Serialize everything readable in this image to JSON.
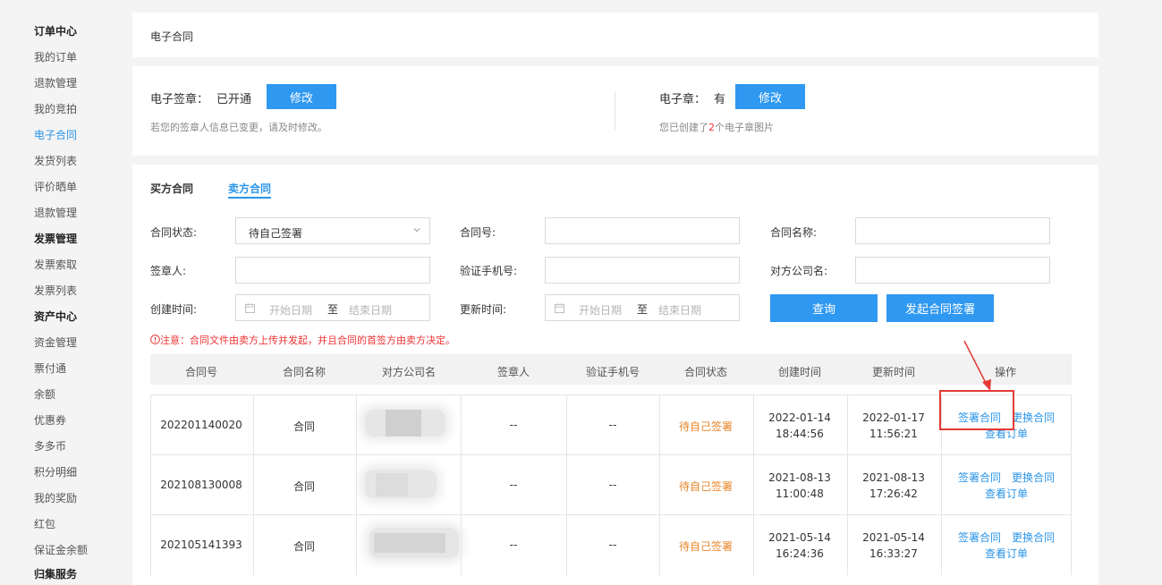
{
  "sidebar": {
    "items": [
      {
        "label": "订单中心",
        "type": "head"
      },
      {
        "label": "我的订单",
        "type": "item"
      },
      {
        "label": "退款管理",
        "type": "item"
      },
      {
        "label": "我的竞拍",
        "type": "item"
      },
      {
        "label": "电子合同",
        "type": "active"
      },
      {
        "label": "发货列表",
        "type": "item"
      },
      {
        "label": "评价晒单",
        "type": "item"
      },
      {
        "label": "退款管理",
        "type": "item"
      },
      {
        "label": "发票管理",
        "type": "head"
      },
      {
        "label": "发票索取",
        "type": "item"
      },
      {
        "label": "发票列表",
        "type": "item"
      },
      {
        "label": "资产中心",
        "type": "head"
      },
      {
        "label": "资金管理",
        "type": "item"
      },
      {
        "label": "票付通",
        "type": "item"
      },
      {
        "label": "余额",
        "type": "item"
      },
      {
        "label": "优惠券",
        "type": "item"
      },
      {
        "label": "多多币",
        "type": "item"
      },
      {
        "label": "积分明细",
        "type": "item"
      },
      {
        "label": "我的奖励",
        "type": "item"
      },
      {
        "label": "红包",
        "type": "item"
      },
      {
        "label": "保证金余额",
        "type": "item"
      },
      {
        "label": "归集服务",
        "type": "head"
      }
    ]
  },
  "breadcrumb": "电子合同",
  "seal_panel": {
    "esign_label": "电子签章：",
    "esign_status": "已开通",
    "esign_button": "修改",
    "esign_hint": "若您的签章人信息已变更，请及时修改。",
    "estamp_label": "电子章：",
    "estamp_status": "有",
    "estamp_button": "修改",
    "estamp_hint_prefix": "您已创建了",
    "estamp_count": "2",
    "estamp_hint_suffix": "个电子章图片"
  },
  "tabs": [
    {
      "label": "买方合同",
      "active": false
    },
    {
      "label": "卖方合同",
      "active": true
    }
  ],
  "filters": {
    "status_label": "合同状态:",
    "status_value": "待自己签署",
    "contract_no_label": "合同号:",
    "contract_name_label": "合同名称:",
    "signer_label": "签章人:",
    "verify_phone_label": "验证手机号:",
    "counterparty_label": "对方公司名:",
    "created_label": "创建时间:",
    "updated_label": "更新时间:",
    "start_placeholder": "开始日期",
    "to": "至",
    "end_placeholder": "结束日期",
    "query_button": "查询",
    "initiate_button": "发起合同签署"
  },
  "notice_icon": "exclamation-circle-icon",
  "notice": "注意：合同文件由卖方上传并发起，并且合同的首签方由卖方决定。",
  "table": {
    "headers": [
      "合同号",
      "合同名称",
      "对方公司名",
      "签章人",
      "验证手机号",
      "合同状态",
      "创建时间",
      "更新时间",
      "操作"
    ],
    "rows": [
      {
        "no": "202201140020",
        "name": "合同",
        "company": "",
        "signer": "--",
        "phone": "--",
        "status": "待自己签署",
        "created_date": "2022-01-14",
        "created_time": "18:44:56",
        "updated_date": "2022-01-17",
        "updated_time": "11:56:21",
        "action_sign": "签署合同",
        "action_replace": "更换合同",
        "action_view": "查看订单"
      },
      {
        "no": "202108130008",
        "name": "合同",
        "company": "",
        "signer": "--",
        "phone": "--",
        "status": "待自己签署",
        "created_date": "2021-08-13",
        "created_time": "11:00:48",
        "updated_date": "2021-08-13",
        "updated_time": "17:26:42",
        "action_sign": "签署合同",
        "action_replace": "更换合同",
        "action_view": "查看订单"
      },
      {
        "no": "202105141393",
        "name": "合同",
        "company": "",
        "signer": "--",
        "phone": "--",
        "status": "待自己签署",
        "created_date": "2021-05-14",
        "created_time": "16:24:36",
        "updated_date": "2021-05-14",
        "updated_time": "16:33:27",
        "action_sign": "签署合同",
        "action_replace": "更换合同",
        "action_view": "查看订单"
      }
    ]
  },
  "colors": {
    "accent": "#2b95e8",
    "button": "#2f98f0",
    "status": "#e8862a",
    "warning": "#e33333",
    "annotation": "#e53935"
  }
}
